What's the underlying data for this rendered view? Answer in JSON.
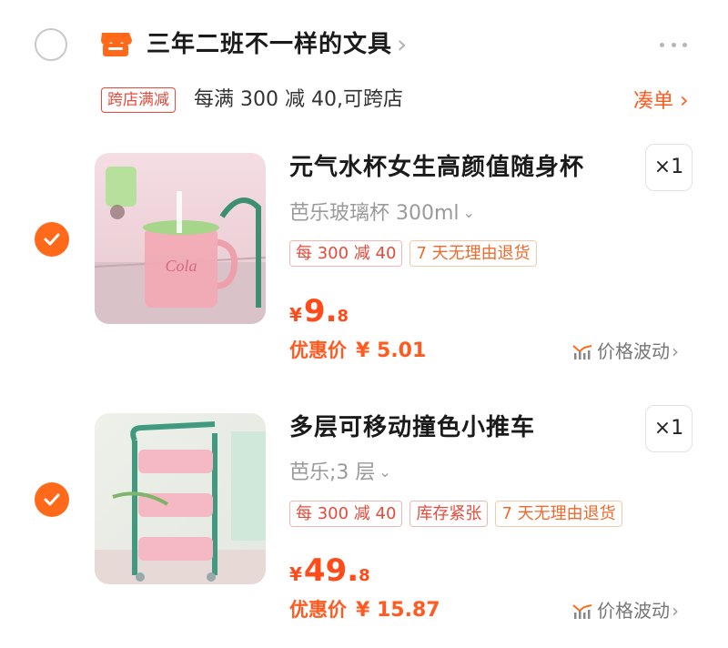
{
  "shop": {
    "name": "三年二班不一样的文具",
    "chevron": "›",
    "more": "···",
    "promo_tag": "跨店满减",
    "promo_text": "每满 300 减 40,可跨店",
    "promo_link": "凑单",
    "promo_link_chevron": "›"
  },
  "items": [
    {
      "title": "元气水杯女生高颜值随身杯",
      "qty": "×1",
      "sku": "芭乐玻璃杯 300ml",
      "sku_chevron": "⌄",
      "tags": [
        "每 300 减 40",
        "7 天无理由退货"
      ],
      "price_symbol": "¥",
      "price_int": "9.",
      "price_dec": "8",
      "discount_label": "优惠价",
      "discount_price": "¥ 5.01",
      "trend_label": "价格波动",
      "trend_chevron": "›"
    },
    {
      "title": "多层可移动撞色小推车",
      "qty": "×1",
      "sku": "芭乐;3 层",
      "sku_chevron": "⌄",
      "tags": [
        "每 300 减 40",
        "库存紧张",
        "7 天无理由退货"
      ],
      "price_symbol": "¥",
      "price_int": "49.",
      "price_dec": "8",
      "discount_label": "优惠价",
      "discount_price": "¥ 15.87",
      "trend_label": "价格波动",
      "trend_chevron": "›"
    }
  ],
  "colors": {
    "accent": "#ff5a1f",
    "price": "#ff4a1a",
    "tag_red": "#e64a3b",
    "check": "#ff6a1a"
  },
  "icons": [
    "shop-icon",
    "more-icon",
    "check-icon",
    "price-trend-icon"
  ]
}
